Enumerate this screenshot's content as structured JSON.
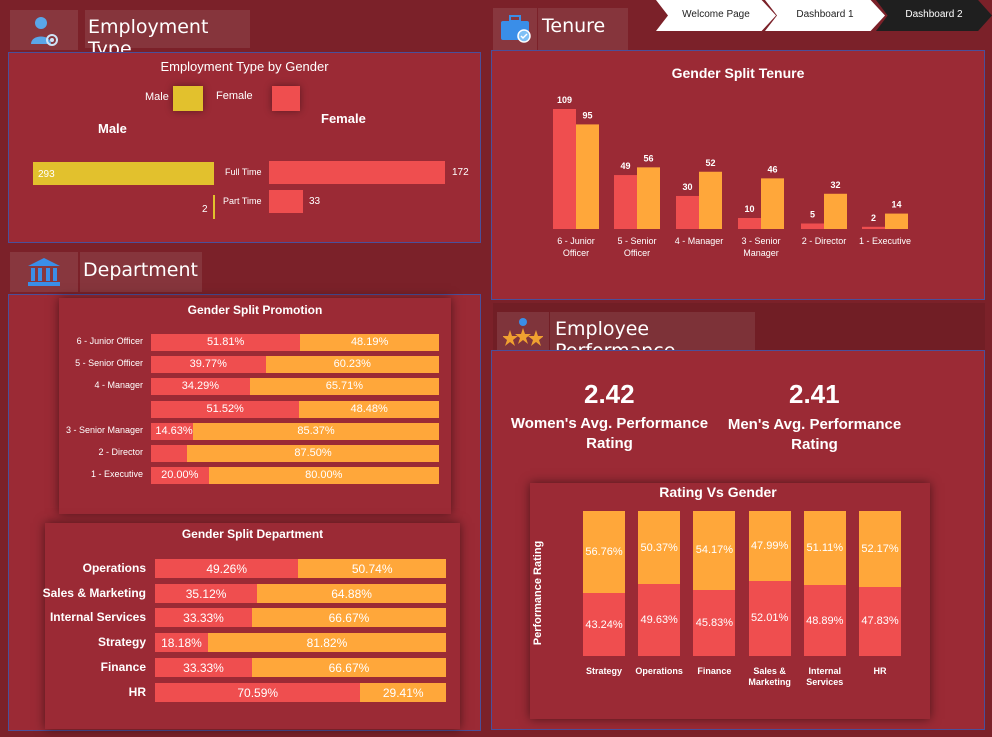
{
  "colors": {
    "female": "#ef4e4f",
    "male": "#ffa73a",
    "male_emp": "#e2c12d",
    "panel": "#9b2a35",
    "bg": "#7b2129"
  },
  "nav": {
    "items": [
      "Welcome Page",
      "Dashboard 1",
      "Dashboard 2"
    ],
    "active": "Dashboard 2"
  },
  "employment": {
    "header": "Employment Type",
    "title": "Employment Type  by Gender",
    "legend_male": "Male",
    "legend_female": "Female",
    "col_male": "Male",
    "col_female": "Female",
    "rows": [
      {
        "label": "Full Time",
        "male": "293",
        "female": "172"
      },
      {
        "label": "Part Time",
        "male": "2",
        "female": "33"
      }
    ]
  },
  "department": {
    "header": "Department",
    "promo_title": "Gender Split Promotion",
    "promo_rows": [
      {
        "label": "6 - Junior Officer",
        "f": "51.81%",
        "m": "48.19%"
      },
      {
        "label": "5 - Senior Officer",
        "f": "39.77%",
        "m": "60.23%"
      },
      {
        "label": "4 - Manager",
        "f": "34.29%",
        "m": "65.71%"
      },
      {
        "label": "",
        "f": "51.52%",
        "m": "48.48%"
      },
      {
        "label": "3 - Senior Manager",
        "f": "14.63%",
        "m": "85.37%"
      },
      {
        "label": "2 - Director",
        "f": "",
        "m": "87.50%"
      },
      {
        "label": "1 - Executive",
        "f": "20.00%",
        "m": "80.00%"
      }
    ],
    "dept_title": "Gender Split Department",
    "dept_rows": [
      {
        "label": "Operations",
        "f": "49.26%",
        "m": "50.74%"
      },
      {
        "label": "Sales & Marketing",
        "f": "35.12%",
        "m": "64.88%"
      },
      {
        "label": "Internal Services",
        "f": "33.33%",
        "m": "66.67%"
      },
      {
        "label": "Strategy",
        "f": "18.18%",
        "m": "81.82%"
      },
      {
        "label": "Finance",
        "f": "33.33%",
        "m": "66.67%"
      },
      {
        "label": "HR",
        "f": "70.59%",
        "m": "29.41%"
      }
    ]
  },
  "tenure": {
    "header": "Tenure",
    "title": "Gender Split Tenure"
  },
  "performance": {
    "header": "Employee Performance",
    "women_value": "2.42",
    "women_label_1": "Women's Avg. Performance",
    "women_label_2": "Rating",
    "men_value": "2.41",
    "men_label_1": "Men's Avg. Performance",
    "men_label_2": "Rating",
    "chart_title": "Rating Vs Gender",
    "y_axis": "Performance Rating"
  },
  "chart_data": [
    {
      "type": "bar",
      "title": "Employment Type  by Gender",
      "categories": [
        "Full Time",
        "Part Time"
      ],
      "series": [
        {
          "name": "Male",
          "values": [
            293,
            2
          ]
        },
        {
          "name": "Female",
          "values": [
            172,
            33
          ]
        }
      ]
    },
    {
      "type": "bar",
      "title": "Gender Split Tenure",
      "categories": [
        "6 - Junior Officer",
        "5 - Senior Officer",
        "4 - Manager",
        "3 - Senior Manager",
        "2 - Director",
        "1 - Executive"
      ],
      "series": [
        {
          "values": [
            109,
            49,
            30,
            10,
            5,
            2
          ]
        },
        {
          "values": [
            95,
            56,
            52,
            46,
            32,
            14
          ]
        }
      ],
      "ylim": [
        0,
        115
      ]
    },
    {
      "type": "bar",
      "title": "Gender Split Promotion",
      "categories": [
        "6 - Junior Officer",
        "5 - Senior Officer",
        "4 - Manager",
        "",
        "3 - Senior Manager",
        "2 - Director",
        "1 - Executive"
      ],
      "series": [
        {
          "values": [
            51.81,
            39.77,
            34.29,
            51.52,
            14.63,
            12.5,
            20.0
          ]
        },
        {
          "values": [
            48.19,
            60.23,
            65.71,
            48.48,
            85.37,
            87.5,
            80.0
          ]
        }
      ]
    },
    {
      "type": "bar",
      "title": "Gender Split Department",
      "categories": [
        "Operations",
        "Sales & Marketing",
        "Internal Services",
        "Strategy",
        "Finance",
        "HR"
      ],
      "series": [
        {
          "values": [
            49.26,
            35.12,
            33.33,
            18.18,
            33.33,
            70.59
          ]
        },
        {
          "values": [
            50.74,
            64.88,
            66.67,
            81.82,
            66.67,
            29.41
          ]
        }
      ]
    },
    {
      "type": "bar",
      "title": "Rating Vs Gender",
      "ylabel": "Performance Rating",
      "categories": [
        "Strategy",
        "Operations",
        "Finance",
        "Sales & Marketing",
        "Internal Services",
        "HR"
      ],
      "series": [
        {
          "values": [
            43.24,
            49.63,
            45.83,
            52.01,
            48.89,
            47.83
          ]
        },
        {
          "values": [
            56.76,
            50.37,
            54.17,
            47.99,
            51.11,
            52.17
          ]
        }
      ]
    }
  ]
}
